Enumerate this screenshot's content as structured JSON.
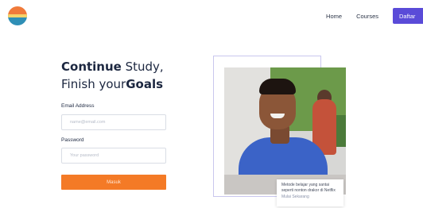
{
  "header": {
    "nav_home": "Home",
    "nav_courses": "Courses",
    "nav_button": "Daftar"
  },
  "form": {
    "title_line1_bold": "Continue",
    "title_line1_rest": " Study,",
    "title_line2_pre": "Finish your",
    "title_line2_bold": "Goals",
    "email_label": "Email Address",
    "email_placeholder": "name@email.com",
    "password_label": "Password",
    "password_placeholder": "Your password",
    "submit_label": "Masuk"
  },
  "caption": {
    "line1": "Metode belajar yang santai",
    "line2": "seperti nonton drakor di Netflix",
    "link": "Mulai Sekarang"
  },
  "colors": {
    "primary": "#5a4bd8",
    "accent": "#f47a26"
  },
  "icons": {
    "logo": "brand-logo"
  }
}
